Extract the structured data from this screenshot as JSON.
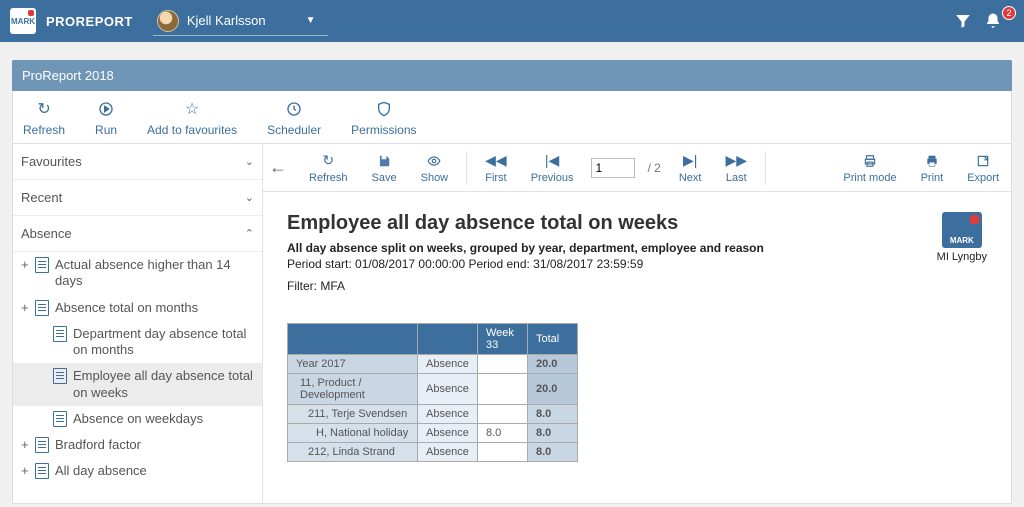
{
  "header": {
    "product": "PROREPORT",
    "brand_small": "MARK",
    "user_name": "Kjell Karlsson",
    "notification_count": "2"
  },
  "page": {
    "title": "ProReport 2018"
  },
  "toolbar": {
    "refresh": "Refresh",
    "run": "Run",
    "favourites": "Add to favourites",
    "scheduler": "Scheduler",
    "permissions": "Permissions"
  },
  "sidebar": {
    "favourites_label": "Favourites",
    "recent_label": "Recent",
    "category_label": "Absence",
    "tree": [
      {
        "label": "Actual absence higher than 14 days",
        "expandable": true
      },
      {
        "label": "Absence total on months",
        "expandable": true
      },
      {
        "label": "Department day absence total on months",
        "expandable": false
      },
      {
        "label": "Employee all day absence total on weeks",
        "expandable": false,
        "selected": true
      },
      {
        "label": "Absence on weekdays",
        "expandable": false
      },
      {
        "label": "Bradford factor",
        "expandable": true
      },
      {
        "label": "All day absence",
        "expandable": true
      }
    ]
  },
  "viewer": {
    "refresh": "Refresh",
    "save": "Save",
    "show": "Show",
    "first": "First",
    "previous": "Previous",
    "next": "Next",
    "last": "Last",
    "print_mode": "Print mode",
    "print": "Print",
    "export": "Export",
    "page_current": "1",
    "page_total": "/  2"
  },
  "report": {
    "title": "Employee all day absence total on weeks",
    "subtitle": "All day absence split on weeks, grouped by year, department, employee and reason",
    "period": "Period start: 01/08/2017 00:00:00  Period end: 31/08/2017 23:59:59",
    "filter": "Filter: MFA",
    "company_brand": "MARK",
    "company_name": "MI Lyngby",
    "columns": {
      "week": "Week 33",
      "total": "Total"
    },
    "rows": [
      {
        "label": "Year 2017",
        "type": "Absence",
        "week": "",
        "total": "20.0",
        "level": 0
      },
      {
        "label": "11, Product / Development",
        "type": "Absence",
        "week": "",
        "total": "20.0",
        "level": 1
      },
      {
        "label": "211, Terje Svendsen",
        "type": "Absence",
        "week": "",
        "total": "8.0",
        "level": 2
      },
      {
        "label": "H, National holiday",
        "type": "Absence",
        "week": "8.0",
        "total": "8.0",
        "level": 3
      },
      {
        "label": "212, Linda Strand",
        "type": "Absence",
        "week": "",
        "total": "8.0",
        "level": 2
      }
    ]
  }
}
